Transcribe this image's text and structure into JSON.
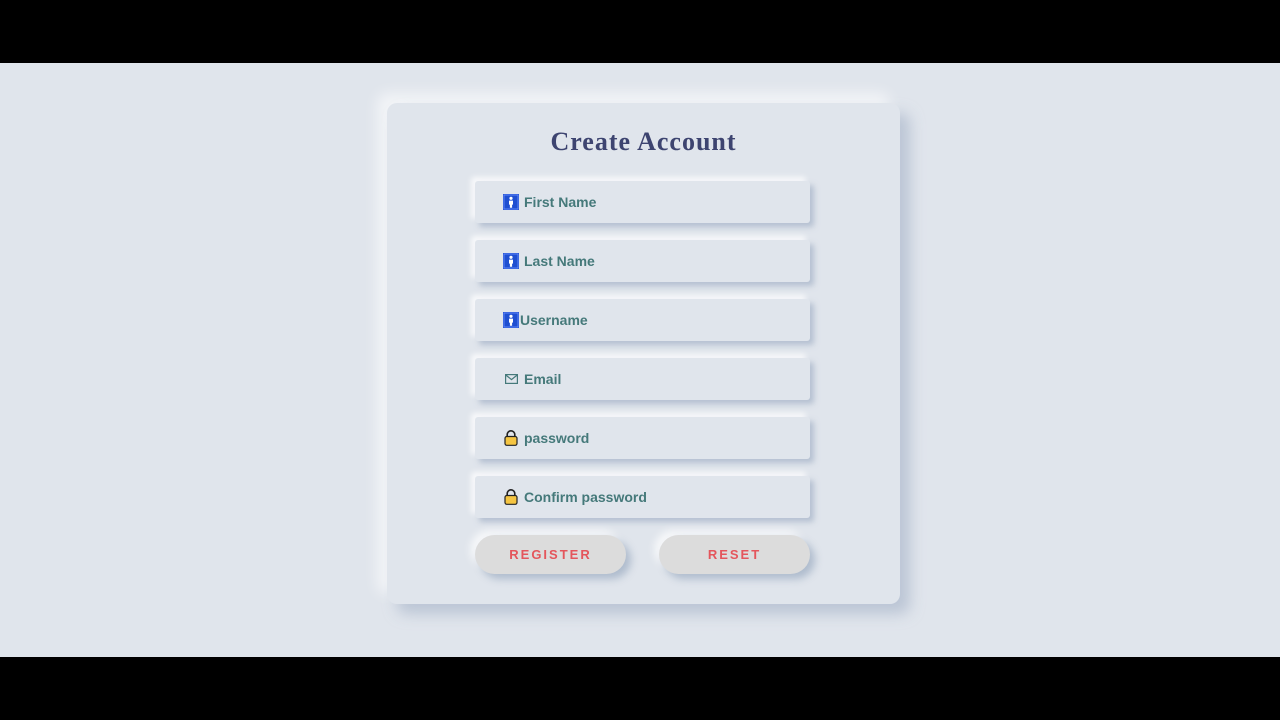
{
  "form": {
    "title": "Create Account",
    "fields": [
      {
        "label": "First Name",
        "icon": "person-icon"
      },
      {
        "label": "Last Name",
        "icon": "person-icon"
      },
      {
        "label": "Username",
        "icon": "person-icon"
      },
      {
        "label": "Email",
        "icon": "envelope-icon"
      },
      {
        "label": "password",
        "icon": "lock-icon"
      },
      {
        "label": "Confirm password",
        "icon": "lock-icon"
      }
    ],
    "register_label": "REGISTER",
    "reset_label": "RESET"
  },
  "colors": {
    "background": "#e0e5ec",
    "title": "#3d4470",
    "field_text": "#45797a",
    "button_text": "#e4565c",
    "person_icon_bg": "#1f4fd1",
    "lock_icon": "#f5c542"
  }
}
